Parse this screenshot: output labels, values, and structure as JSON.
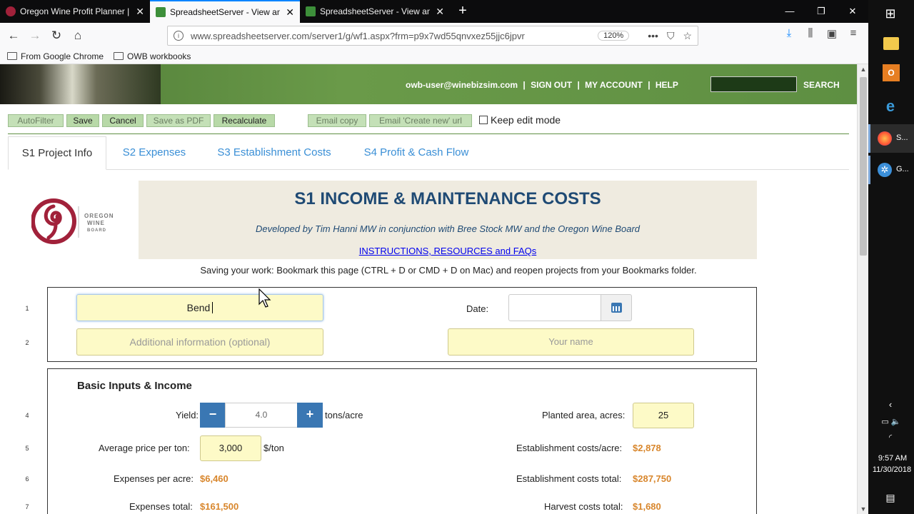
{
  "browser": {
    "tabs": [
      {
        "title": "Oregon Wine Profit Planner | O",
        "active": false
      },
      {
        "title": "SpreadsheetServer - View and e",
        "active": true
      },
      {
        "title": "SpreadsheetServer - View and e",
        "active": false
      }
    ],
    "close_glyph": "✕",
    "newtab_glyph": "+",
    "url": "www.spreadsheetserver.com/server1/g/wf1.aspx?frm=p9x7wd55qnvxez55jjc6jpvr",
    "zoom": "120%",
    "bookmarks": [
      "From Google Chrome",
      "OWB workbooks"
    ]
  },
  "header": {
    "user_email": "owb-user@winebizsim.com",
    "sign_out": "SIGN OUT",
    "my_account": "MY ACCOUNT",
    "help": "HELP",
    "separator": "|",
    "search": "SEARCH"
  },
  "toolbar": {
    "autofilter": "AutoFilter",
    "save": "Save",
    "cancel": "Cancel",
    "save_pdf": "Save as PDF",
    "recalculate": "Recalculate",
    "email_copy": "Email copy",
    "email_create": "Email 'Create new' url",
    "keep_edit": "Keep edit mode"
  },
  "sheet_tabs": [
    "S1 Project Info",
    "S2 Expenses",
    "S3 Establishment Costs",
    "S4 Profit & Cash Flow"
  ],
  "logo": {
    "line1": "OREGON",
    "line2": "WINE",
    "line3": "BOARD"
  },
  "banner": {
    "title": "S1 INCOME & MAINTENANCE COSTS",
    "developed_by": "Developed by Tim Hanni MW in conjunction with Bree Stock MW and the Oregon Wine Board",
    "instructions_link": "INSTRUCTIONS, RESOURCES and FAQs"
  },
  "saving_note": "Saving your work: Bookmark this page (CTRL + D or CMD + D on Mac) and reopen projects from your Bookmarks folder.",
  "row_numbers": [
    "1",
    "2",
    "4",
    "5",
    "6",
    "7"
  ],
  "project": {
    "name_value": "Bend",
    "additional_placeholder": "Additional information (optional)",
    "date_label": "Date:",
    "your_name_placeholder": "Your name"
  },
  "basic": {
    "section_title": "Basic Inputs & Income",
    "yield_label": "Yield:",
    "yield_value": "4.0",
    "yield_unit": "tons/acre",
    "minus": "−",
    "plus": "+",
    "planted_label": "Planted area, acres:",
    "planted_value": "25",
    "avg_price_label": "Average price per ton:",
    "avg_price_value": "3,000",
    "avg_price_unit": "$/ton",
    "est_costs_acre_label": "Establishment costs/acre:",
    "est_costs_acre_value": "$2,878",
    "expenses_acre_label": "Expenses per acre:",
    "expenses_acre_value": "$6,460",
    "est_costs_total_label": "Establishment costs total:",
    "est_costs_total_value": "$287,750",
    "expenses_total_label": "Expenses total:",
    "expenses_total_value": "$161,500",
    "harvest_total_label": "Harvest costs total:",
    "harvest_total_value": "$1,680"
  },
  "taskbar": {
    "firefox_label": "S...",
    "chrome_label": "G...",
    "time": "9:57 AM",
    "date": "11/30/2018"
  }
}
